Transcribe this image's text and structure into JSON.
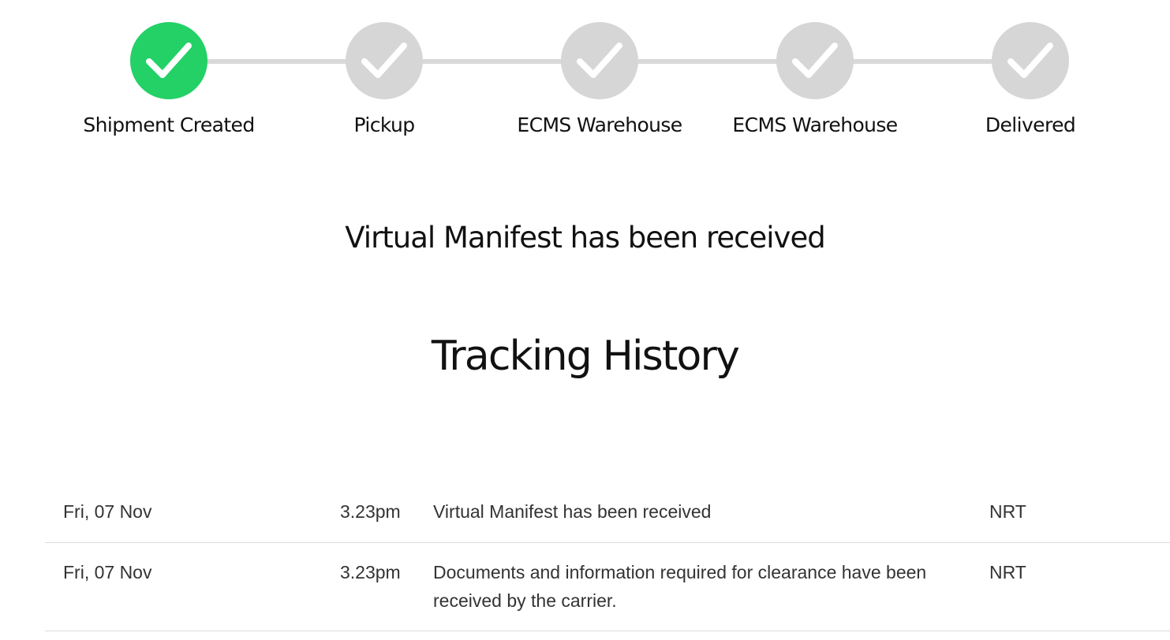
{
  "steps": [
    {
      "label": "Shipment Created",
      "status": "complete",
      "icon": "check-icon"
    },
    {
      "label": "Pickup",
      "status": "pending",
      "icon": "check-icon"
    },
    {
      "label": "ECMS Warehouse",
      "status": "pending",
      "icon": "check-icon"
    },
    {
      "label": "ECMS Warehouse",
      "status": "pending",
      "icon": "check-icon"
    },
    {
      "label": "Delivered",
      "status": "pending",
      "icon": "check-icon"
    }
  ],
  "colors": {
    "complete": "#23d166",
    "pending": "#d6d6d6",
    "line": "#d9d9d9"
  },
  "status_headline": "Virtual Manifest has been received",
  "history_title": "Tracking History",
  "history": [
    {
      "date": "Fri, 07 Nov",
      "time": "3.23pm",
      "description": "Virtual Manifest has been received",
      "location": "NRT"
    },
    {
      "date": "Fri, 07 Nov",
      "time": "3.23pm",
      "description": "Documents and information required for clearance have been received by the carrier.",
      "location": "NRT"
    }
  ]
}
